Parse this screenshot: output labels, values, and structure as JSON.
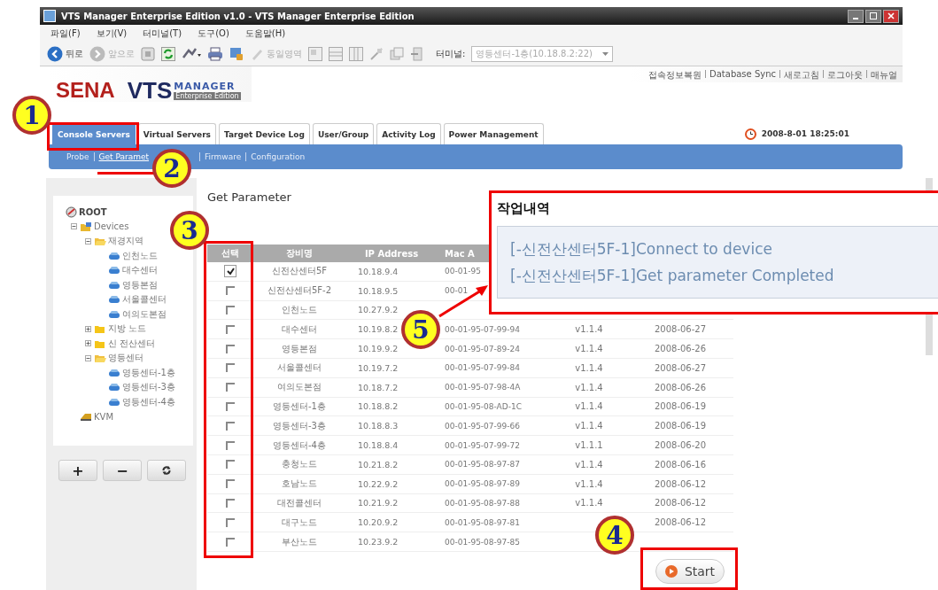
{
  "window": {
    "title": "VTS Manager Enterprise Edition v1.0 - VTS Manager Enterprise Edition"
  },
  "menu": [
    "파일(F)",
    "보기(V)",
    "터미널(T)",
    "도구(O)",
    "도움말(H)"
  ],
  "toolbar": {
    "back": "뒤로",
    "forward": "앞으로",
    "same_area": "동일영역",
    "terminal_label": "터미널:",
    "terminal_value": "영등센터-1층(10.18.8.2:22)"
  },
  "header_links": [
    "접속정보복원",
    "Database Sync",
    "새로고침",
    "로그아웃",
    "매뉴얼"
  ],
  "logo": {
    "brand": "SENA",
    "product": "VTS",
    "product_sub": "MANAGER",
    "edition": "Enterprise Edition"
  },
  "tabs": [
    {
      "label": "Console Servers",
      "selected": true
    },
    {
      "label": "Virtual Servers",
      "selected": false
    },
    {
      "label": "Target Device Log",
      "selected": false
    },
    {
      "label": "User/Group",
      "selected": false
    },
    {
      "label": "Activity Log",
      "selected": false
    },
    {
      "label": "Power Management",
      "selected": false
    }
  ],
  "datetime": "2008-8-01  18:25:01",
  "subnav": [
    {
      "label": "Probe",
      "selected": false
    },
    {
      "label": "Get Paramet",
      "selected": true
    },
    {
      "label": "Firmware",
      "selected": false
    },
    {
      "label": "Configuration",
      "selected": false
    }
  ],
  "tree": [
    {
      "label": "ROOT",
      "kind": "root",
      "children": [
        {
          "label": "Devices",
          "kind": "group",
          "expanded": true,
          "children": [
            {
              "label": "재경지역",
              "kind": "folder",
              "expanded": true,
              "children": [
                {
                  "label": "인천노드",
                  "kind": "device"
                },
                {
                  "label": "대수센터",
                  "kind": "device"
                },
                {
                  "label": "영등본점",
                  "kind": "device"
                },
                {
                  "label": "서울콜센터",
                  "kind": "device"
                },
                {
                  "label": "여의도본점",
                  "kind": "device"
                }
              ]
            },
            {
              "label": "지방 노드",
              "kind": "folder",
              "expanded": false
            },
            {
              "label": "신 전산센터",
              "kind": "folder",
              "expanded": false
            },
            {
              "label": "영등센터",
              "kind": "folder",
              "expanded": true,
              "children": [
                {
                  "label": "영등센터-1층",
                  "kind": "device"
                },
                {
                  "label": "영등센터-3층",
                  "kind": "device"
                },
                {
                  "label": "영등센터-4층",
                  "kind": "device"
                }
              ]
            }
          ]
        },
        {
          "label": "KVM",
          "kind": "kvm"
        }
      ]
    }
  ],
  "tree_buttons": [
    {
      "label": "+",
      "kind": "text"
    },
    {
      "label": "−",
      "kind": "text"
    },
    {
      "kind": "refresh"
    }
  ],
  "panel_title": "Get Parameter",
  "table": {
    "columns": [
      "선택",
      "장비명",
      "IP Address",
      "Mac A"
    ],
    "rows": [
      {
        "checked": true,
        "name": "신전산센터5F",
        "ip": "10.18.9.4",
        "mac": "00-01-95"
      },
      {
        "checked": false,
        "name": "신전산센터5F-2",
        "ip": "10.18.9.5",
        "mac": "00-01"
      },
      {
        "checked": false,
        "name": "인천노드",
        "ip": "10.27.9.2"
      },
      {
        "checked": false,
        "name": "대수센터",
        "ip": "10.19.8.2",
        "mac": "00-01-95-07-99-94",
        "version": "v1.1.4",
        "date": "2008-06-27"
      },
      {
        "checked": false,
        "name": "영등본점",
        "ip": "10.19.9.2",
        "mac": "00-01-95-07-89-24",
        "version": "v1.1.4",
        "date": "2008-06-26"
      },
      {
        "checked": false,
        "name": "서울콜센터",
        "ip": "10.19.7.2",
        "mac": "00-01-95-07-99-84",
        "version": "v1.1.4",
        "date": "2008-06-27"
      },
      {
        "checked": false,
        "name": "여의도본점",
        "ip": "10.18.7.2",
        "mac": "00-01-95-07-98-4A",
        "version": "v1.1.4",
        "date": "2008-06-26"
      },
      {
        "checked": false,
        "name": "영등센터-1층",
        "ip": "10.18.8.2",
        "mac": "00-01-95-08-AD-1C",
        "version": "v1.1.4",
        "date": "2008-06-19"
      },
      {
        "checked": false,
        "name": "영등센터-3층",
        "ip": "10.18.8.3",
        "mac": "00-01-95-07-99-66",
        "version": "v1.1.4",
        "date": "2008-06-19"
      },
      {
        "checked": false,
        "name": "영등센터-4층",
        "ip": "10.18.8.4",
        "mac": "00-01-95-07-99-72",
        "version": "v1.1.1",
        "date": "2008-06-20"
      },
      {
        "checked": false,
        "name": "충청노드",
        "ip": "10.21.8.2",
        "mac": "00-01-95-08-97-87",
        "version": "v1.1.4",
        "date": "2008-06-16"
      },
      {
        "checked": false,
        "name": "호남노드",
        "ip": "10.22.9.2",
        "mac": "00-01-95-08-97-89",
        "version": "v1.1.4",
        "date": "2008-06-12"
      },
      {
        "checked": false,
        "name": "대전콜센터",
        "ip": "10.21.9.2",
        "mac": "00-01-95-08-97-88",
        "version": "v1.1.4",
        "date": "2008-06-12"
      },
      {
        "checked": false,
        "name": "대구노드",
        "ip": "10.20.9.2",
        "mac": "00-01-95-08-97-81",
        "date": "2008-06-12"
      },
      {
        "checked": false,
        "name": "부산노드",
        "ip": "10.23.9.2",
        "mac": "00-01-95-08-97-85"
      }
    ]
  },
  "log": {
    "title": "작업내역",
    "lines": [
      "[-신전산센터5F-1]Connect to device",
      "[-신전산센터5F-1]Get parameter Completed"
    ]
  },
  "start_button": "Start",
  "annotations": [
    {
      "label": "1",
      "kind": "tab"
    },
    {
      "label": "2",
      "kind": "subnav"
    },
    {
      "label": "3",
      "kind": "checkbox"
    },
    {
      "label": "4",
      "kind": "start"
    },
    {
      "label": "5",
      "kind": "log"
    }
  ]
}
